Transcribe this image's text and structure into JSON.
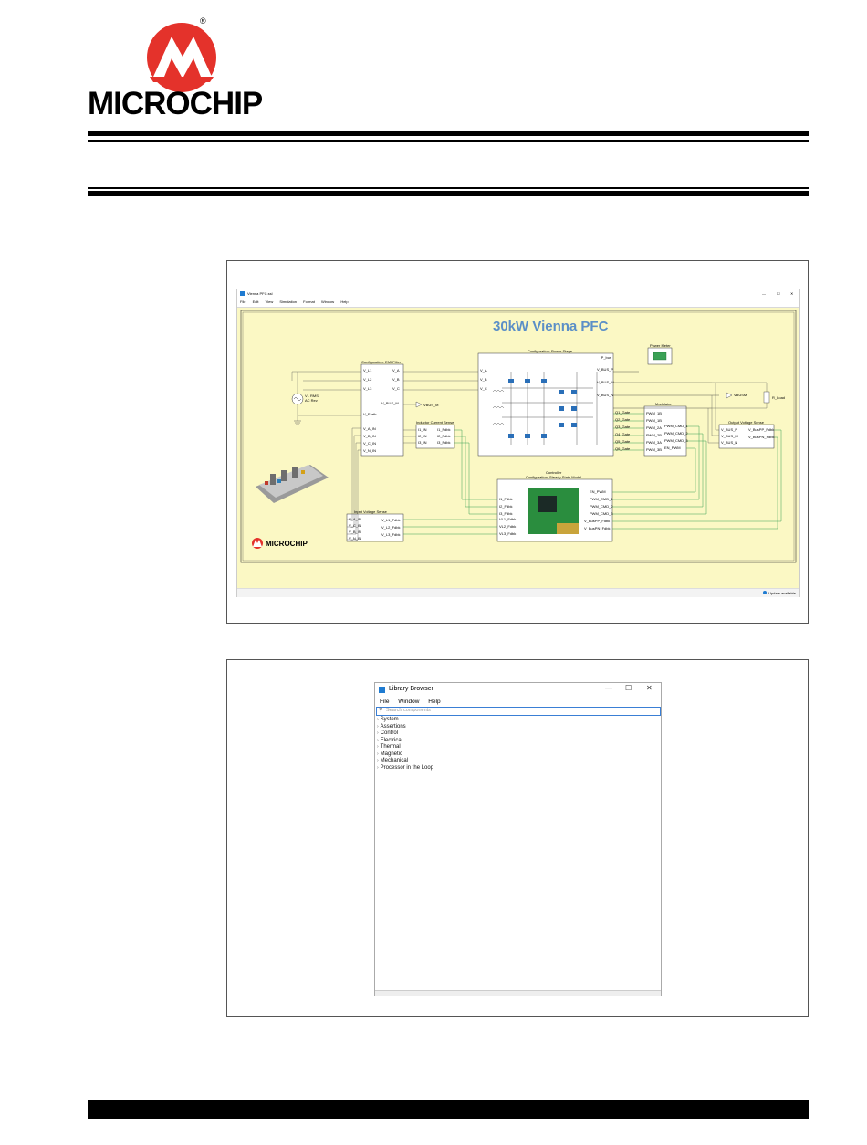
{
  "logo": {
    "brand": "MICROCHIP",
    "registered": "®"
  },
  "figure1": {
    "window_title": "Vienna PFC.ssl",
    "menu": [
      "File",
      "Edit",
      "View",
      "Simulation",
      "Format",
      "Window",
      "Help"
    ],
    "window_controls": [
      "—",
      "☐",
      "✕"
    ],
    "schematic_title": "30kW Vienna PFC",
    "source_label": [
      "V1 RMS",
      "AC Rev"
    ],
    "blocks": {
      "emi_filter": {
        "title": "Configuration: EMI Filter",
        "left_ports": [
          "V_L1",
          "V_L2",
          "V_L3",
          "V_Earth"
        ],
        "right_ports": [
          "V_A",
          "V_B",
          "V_C",
          "V_BUS_M"
        ],
        "bottom_ports": [
          "V_A_IN",
          "V_B_IN",
          "V_C_IN",
          "V_N_IN"
        ]
      },
      "power_stage": {
        "title": "Configuration: Power Stage",
        "left_ports": [
          "V_A",
          "V_B",
          "V_C"
        ],
        "right_ports": [
          "P_bus",
          "V_BUS_P",
          "V_BUS_M",
          "V_BUS_N"
        ],
        "bottom_ports": [
          "Q1_Gate",
          "Q2_Gate",
          "Q3_Gate",
          "Q4_Gate",
          "Q5_Gate",
          "Q6_Gate"
        ]
      },
      "power_meter": {
        "title": "Power Meter"
      },
      "inductor_current": {
        "title": "Inductor Current Sense",
        "left_ports": [
          "I1_IN",
          "I2_IN",
          "I3_IN"
        ],
        "right_ports": [
          "I1_Fdbk",
          "I2_Fdbk",
          "I3_Fdbk"
        ]
      },
      "modulator": {
        "title": "Modulator",
        "left_ports": [
          "PWM_1B",
          "PWM_1B",
          "PWM_2A",
          "PWM_2B",
          "PWM_3A",
          "PWM_3B"
        ],
        "right_ports": [
          "PWM_CMD_1",
          "PWM_CMD_2",
          "PWM_CMD_3",
          "EN_PWM"
        ]
      },
      "output_voltage": {
        "title": "Output Voltage Sense",
        "left_ports": [
          "V_BUS_P",
          "V_BUS_M",
          "V_BUS_N"
        ],
        "right_ports": [
          "V_BusPP_Fdbk",
          "V_BusPN_Fdbk"
        ]
      },
      "controller": {
        "title": "Controller",
        "subtitle": "Configuration: Steady-State Model",
        "left_ports": [
          "I1_Fdbk",
          "I2_Fdbk",
          "I3_Fdbk"
        ],
        "left_ports_2": [
          "VL1_Fdbk",
          "VL2_Fdbk",
          "VL3_Fdbk"
        ],
        "right_ports": [
          "EN_PWM",
          "PWM_CMD_1",
          "PWM_CMD_2",
          "PWM_CMD_3"
        ],
        "right_ports_2": [
          "V_BusPP_Fdbk",
          "V_BusPN_Fdbk"
        ]
      },
      "input_voltage": {
        "title": "Input Voltage Sense",
        "left_ports": [
          "V_A_IN",
          "V_C_IN",
          "V_B_IN",
          "V_N_IN"
        ],
        "right_ports": [
          "V_L1_Fdbk",
          "V_L2_Fdbk",
          "V_L3_Fdbk"
        ]
      }
    },
    "net_labels": {
      "vbus_m": "VBUS_M",
      "vbus_m_load": "VBUSM",
      "load": "R_Load"
    },
    "logo_text": "MICROCHIP",
    "status": "Update available"
  },
  "figure2": {
    "window_title": "Library Browser",
    "menu": [
      "File",
      "Window",
      "Help"
    ],
    "window_controls": [
      "—",
      "☐",
      "✕"
    ],
    "search_placeholder": "Search components",
    "items": [
      "System",
      "Assertions",
      "Control",
      "Electrical",
      "Thermal",
      "Magnetic",
      "Mechanical",
      "Processor in the Loop"
    ]
  }
}
